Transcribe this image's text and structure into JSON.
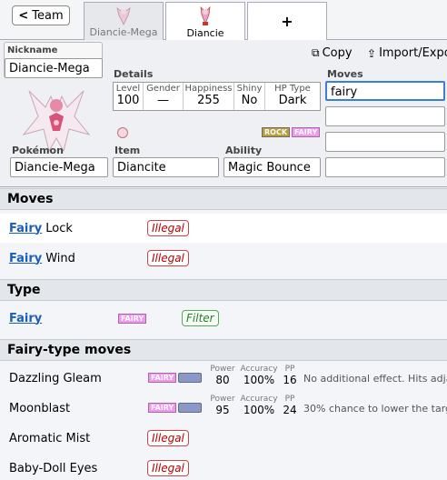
{
  "topbar": {
    "back_label": "Team",
    "tabs": [
      {
        "label": "Diancie-Mega"
      },
      {
        "label": "Diancie"
      }
    ],
    "add_label": "+"
  },
  "editor": {
    "nickname_label": "Nickname",
    "nickname_value": "Diancie-Mega",
    "details_label": "Details",
    "details": [
      {
        "header": "Level",
        "value": "100"
      },
      {
        "header": "Gender",
        "value": "—"
      },
      {
        "header": "Happiness",
        "value": "255"
      },
      {
        "header": "Shiny",
        "value": "No"
      },
      {
        "header": "HP Type",
        "value": "Dark"
      }
    ],
    "types": [
      "ROCK",
      "FAIRY"
    ],
    "pokemon_label": "Pokémon",
    "pokemon_value": "Diancie-Mega",
    "item_label": "Item",
    "item_value": "Diancite",
    "ability_label": "Ability",
    "ability_value": "Magic Bounce",
    "copy_label": "Copy",
    "import_label": "Import/Expo",
    "moves_label": "Moves",
    "move_values": [
      "fairy",
      "",
      "",
      ""
    ]
  },
  "results": {
    "moves_header": "Moves",
    "moves": [
      {
        "link": "Fairy",
        "rest": "Lock",
        "status": "Illegal"
      },
      {
        "link": "Fairy",
        "rest": "Wind",
        "status": "Illegal"
      }
    ],
    "type_header": "Type",
    "type_row": {
      "link": "Fairy",
      "badge": "FAIRY",
      "action": "Filter"
    },
    "fairy_moves_header": "Fairy-type moves",
    "fairy_moves": [
      {
        "name": "Dazzling Gleam",
        "type": "FAIRY",
        "power_label": "Power",
        "power": "80",
        "accuracy_label": "Accuracy",
        "accuracy": "100%",
        "pp_label": "PP",
        "pp": "16",
        "desc": "No additional effect. Hits adja"
      },
      {
        "name": "Moonblast",
        "type": "FAIRY",
        "power_label": "Power",
        "power": "95",
        "accuracy_label": "Accuracy",
        "accuracy": "100%",
        "pp_label": "PP",
        "pp": "24",
        "desc": "30% chance to lower the targ"
      },
      {
        "name": "Aromatic Mist",
        "status": "Illegal"
      },
      {
        "name": "Baby-Doll Eyes",
        "status": "Illegal"
      }
    ]
  }
}
